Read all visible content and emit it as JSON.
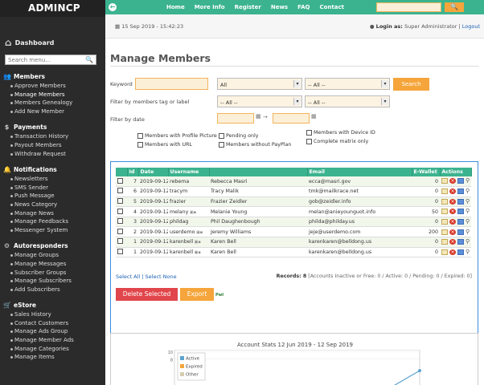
{
  "app": {
    "name": "ADMINCP"
  },
  "sidebar": {
    "dashboard": "Dashboard",
    "search_placeholder": "Search menu...",
    "sections": [
      {
        "title": "Members",
        "icon": "users-icon",
        "items": [
          "Approve Members",
          "Manage Members",
          "Members Genealogy",
          "Add New Member"
        ],
        "active": 1
      },
      {
        "title": "Payments",
        "icon": "money-icon",
        "items": [
          "Transaction History",
          "Payout Members",
          "Withdraw Request"
        ],
        "active": -1
      },
      {
        "title": "Notifications",
        "icon": "bell-icon",
        "items": [
          "Newsletters",
          "SMS Sender",
          "Push Message",
          "News Category",
          "Manage News",
          "Manage Feedbacks",
          "Messenger System"
        ],
        "active": -1
      },
      {
        "title": "Autoresponders",
        "icon": "gear-icon",
        "items": [
          "Manage Groups",
          "Manage Messages",
          "Subscriber Groups",
          "Manage Subscribers",
          "Add Subscribers"
        ],
        "active": -1
      },
      {
        "title": "eStore",
        "icon": "cart-icon",
        "items": [
          "Sales History",
          "Contact Customers",
          "Manage Ads Group",
          "Manage Member Ads",
          "Manage Categories",
          "Manage Items"
        ],
        "active": -1
      }
    ]
  },
  "topbar": {
    "nav": [
      "Home",
      "More Info",
      "Register",
      "News",
      "FAQ",
      "Contact"
    ]
  },
  "header": {
    "date": "15 Sep 2019 - 15:42:23",
    "login_label": "Login as:",
    "login_user": "Super Administrator",
    "logout": "Logout"
  },
  "page": {
    "title": "Manage Members"
  },
  "filters": {
    "keyword_label": "Keyword",
    "field_select": "All",
    "sub_select": "-- All --",
    "search_button": "Search",
    "tag_label": "Filter by members tag or label",
    "tag_select1": "-- All --",
    "tag_select2": "-- All --",
    "date_label": "Filter by date",
    "date_arrow": "→",
    "checkboxes": [
      "Members with Profile Picture",
      "Pending only",
      "Members with Device ID",
      "Members with URL",
      "Members without PayPlan",
      "Complete matrix only"
    ]
  },
  "table": {
    "headers": [
      "",
      "Id",
      "Date",
      "Username",
      "",
      "Email",
      "E-Wallet",
      "Actions"
    ],
    "rows": [
      {
        "id": "7",
        "date": "2019-09-12",
        "username": "rebema",
        "name": "Rebecca Masri",
        "email": "ecca@masri.gov",
        "wallet": "0",
        "flags": ""
      },
      {
        "id": "6",
        "date": "2019-09-12",
        "username": "tracym",
        "name": "Tracy Malik",
        "email": "tmk@mailkrace.net",
        "wallet": "0",
        "flags": ""
      },
      {
        "id": "5",
        "date": "2019-09-12",
        "username": "frazier",
        "name": "Frazier Zeidler",
        "email": "gob@zeidler.info",
        "wallet": "0",
        "flags": ""
      },
      {
        "id": "4",
        "date": "2019-09-12",
        "username": "melany",
        "name": "Melanie Young",
        "email": "melan@anieyounguot.info",
        "wallet": "50",
        "flags": "icons"
      },
      {
        "id": "3",
        "date": "2019-09-12",
        "username": "phildag",
        "name": "Phil Daughenbough",
        "email": "philda@philday.us",
        "wallet": "0",
        "flags": ""
      },
      {
        "id": "2",
        "date": "2019-09-12",
        "username": "userdemo",
        "name": "Jeremy Williams",
        "email": "jeje@userdemo.com",
        "wallet": "200",
        "flags": "icons"
      },
      {
        "id": "1",
        "date": "2019-09-12",
        "username": "karenbell",
        "name": "Karen Bell",
        "email": "karenkaren@belldong.us",
        "wallet": "0",
        "flags": "icons"
      },
      {
        "id": "1",
        "date": "2019-09-12",
        "username": "karenbell",
        "name": "Karen Bell",
        "email": "karenkaren@belldong.us",
        "wallet": "0",
        "flags": "icons"
      }
    ]
  },
  "footer": {
    "select_all": "Select All",
    "separator": " | ",
    "select_none": "Select None",
    "records_label": "Records: 8",
    "records_detail": " [Accounts Inactive or Free: 0 / Active: 0 / Pending: 0 / Expired: 0]",
    "delete_button": "Delete Selected",
    "export_button": "Export",
    "powered": "PwI"
  },
  "chart_data": {
    "type": "line",
    "title": "Account Stats 12 Jun 2019 - 12 Sep 2019",
    "ylim": [
      0,
      10
    ],
    "yticks": [
      "10",
      "8"
    ],
    "legend": [
      "Active",
      "Expired",
      "Other"
    ],
    "colors": {
      "Active": "#5ba3d0",
      "Expired": "#f5a53b",
      "Other": "#d6ccb0"
    },
    "series": [
      {
        "name": "Active",
        "points": [
          [
            0.82,
            0
          ],
          [
            1.0,
            5.5
          ]
        ]
      }
    ]
  },
  "colors": {
    "accent": "#3cb38f",
    "orange": "#f5a53b",
    "danger": "#e0464b",
    "sidebar": "#2b2b2b"
  }
}
